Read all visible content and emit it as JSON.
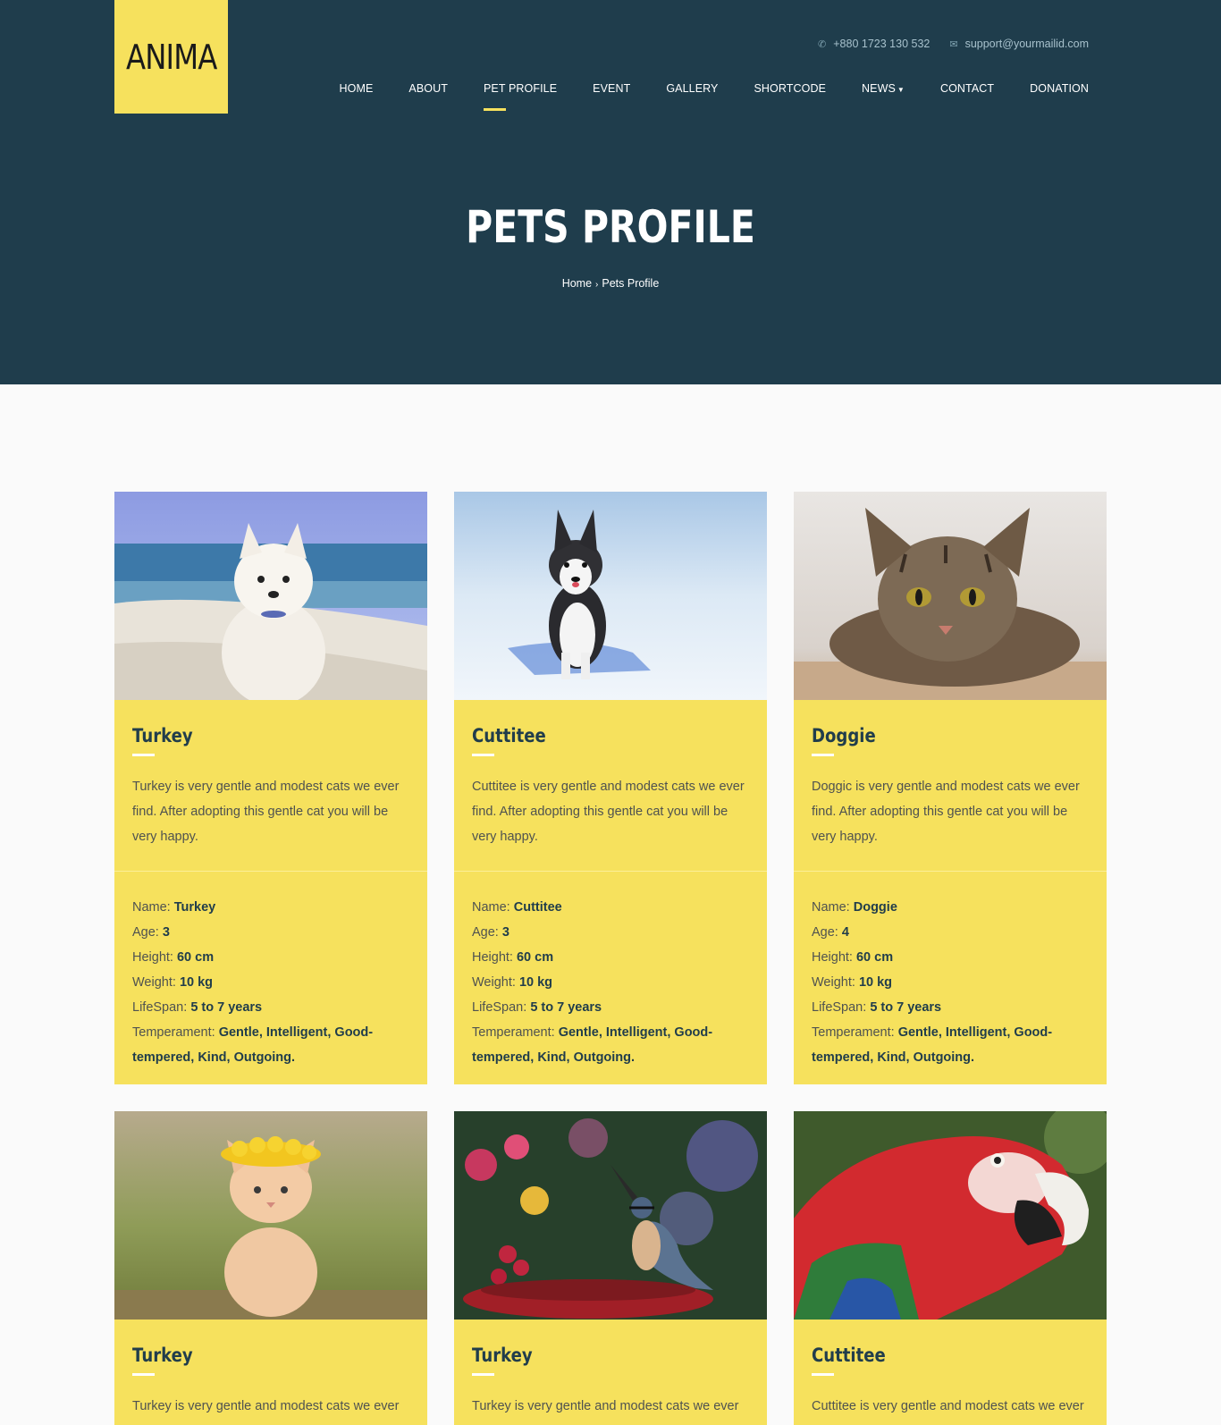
{
  "brand": {
    "logo_text": "ANIMA",
    "accent": "#f6e15d",
    "hero_bg": "#1f3d4c"
  },
  "contact": {
    "phone": "+880 1723 130 532",
    "email": "support@yourmailid.com"
  },
  "nav": {
    "items": [
      {
        "label": "HOME"
      },
      {
        "label": "ABOUT"
      },
      {
        "label": "PET PROFILE",
        "active": true
      },
      {
        "label": "EVENT"
      },
      {
        "label": "GALLERY"
      },
      {
        "label": "SHORTCODE"
      },
      {
        "label": "NEWS",
        "dropdown": true
      },
      {
        "label": "CONTACT"
      },
      {
        "label": "DONATION"
      }
    ]
  },
  "hero": {
    "title": "PETS PROFILE",
    "breadcrumb": [
      "Home",
      "Pets Profile"
    ]
  },
  "labels": {
    "name": "Name:",
    "age": "Age:",
    "height": "Height:",
    "weight": "Weight:",
    "lifespan": "LifeSpan:",
    "temperament": "Temperament:"
  },
  "pets": [
    {
      "name": "Turkey",
      "photo": "white-puppy-on-beach",
      "desc": "Turkey is very gentle and modest cats we ever find. After adopting this gentle cat you will be very happy.",
      "info": {
        "name": "Turkey",
        "age": "3",
        "height": "60 cm",
        "weight": "10 kg",
        "lifespan": "5 to 7 years",
        "temperament": "Gentle, Intelligent, Good-tempered, Kind, Outgoing."
      }
    },
    {
      "name": "Cuttitee",
      "photo": "husky-puppy-in-snow",
      "desc": "Cuttitee is very gentle and modest cats we ever find. After adopting this gentle cat you will be very happy.",
      "info": {
        "name": "Cuttitee",
        "age": "3",
        "height": "60 cm",
        "weight": "10 kg",
        "lifespan": "5 to 7 years",
        "temperament": "Gentle, Intelligent, Good-tempered, Kind, Outgoing."
      }
    },
    {
      "name": "Doggie",
      "photo": "tabby-cat-lying",
      "desc": "Doggic is very gentle and modest cats we ever find. After adopting this gentle cat you will be very happy.",
      "info": {
        "name": "Doggie",
        "age": "4",
        "height": "60 cm",
        "weight": "10 kg",
        "lifespan": "5 to 7 years",
        "temperament": "Gentle, Intelligent, Good-tempered, Kind, Outgoing."
      }
    },
    {
      "name": "Turkey",
      "photo": "kitten-with-flower-crown",
      "desc": "Turkey is very gentle and modest cats we ever find. After adopting this gentle cat you will be very happy."
    },
    {
      "name": "Turkey",
      "photo": "nuthatch-bird-on-bowl",
      "desc": "Turkey is very gentle and modest cats we ever find. After adopting this gentle cat you will be very happy."
    },
    {
      "name": "Cuttitee",
      "photo": "red-macaw-parrot",
      "desc": "Cuttitee is very gentle and modest cats we ever find. After adopting this gentle cat you will be very happy."
    }
  ]
}
